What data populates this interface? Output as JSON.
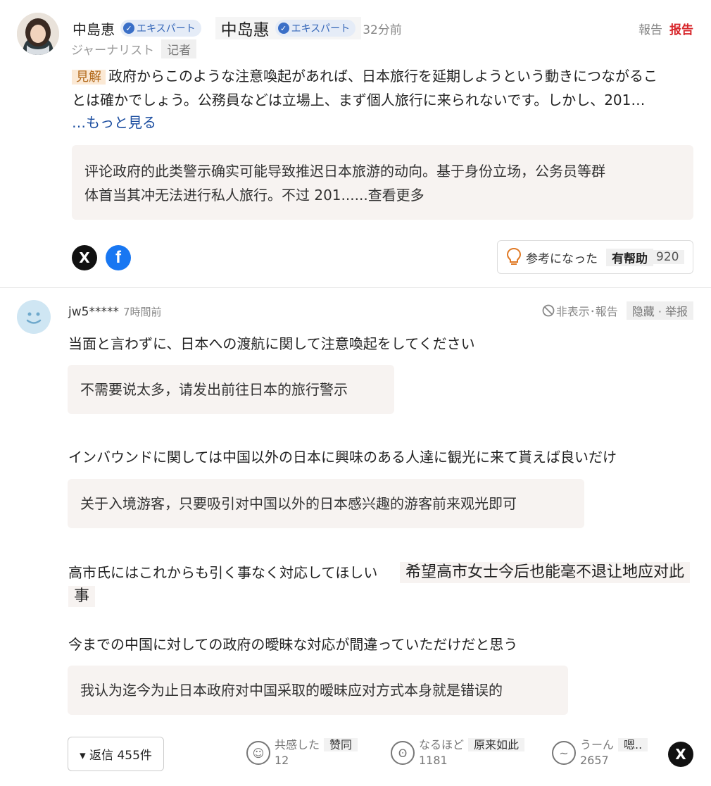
{
  "expert_comment": {
    "author_name": "中島恵",
    "badge": "エキスパート",
    "author_name_zh": "中岛惠",
    "time": "32分前",
    "role": "ジャーナリスト",
    "role_zh": "记者",
    "report_label": "報告",
    "report_label_zh": "报告",
    "opinion_tag": "見解",
    "body_line1": "政府からこのような注意喚起があれば、日本旅行を延期しようという動きにつながるこ",
    "body_line2": "とは確かでしょう。公務員などは立場上、まず個人旅行に来られないです。しかし、201…",
    "see_more": "…もっと見る",
    "translation_line1": "评论政府的此类警示确实可能导致推迟日本旅游的动向。基于身份立场，公务员等群",
    "translation_line2": "体首当其冲无法进行私人旅行。不过 201......查看更多",
    "helpful_label": "参考になった",
    "helpful_label_zh": "有帮助",
    "helpful_count": "920",
    "share_x": "X",
    "share_fb": "f"
  },
  "user_comment": {
    "username": "jw5*****",
    "time": "7時間前",
    "hide_report": "非表示･報告",
    "hide_report_zh": "隐藏 · 举报",
    "paragraphs": [
      {
        "jp": "当面と言わずに、日本への渡航に関して注意喚起をしてください",
        "zh": "不需要说太多，请发出前往日本的旅行警示"
      },
      {
        "jp": "インバウンドに関しては中国以外の日本に興味のある人達に観光に来て貰えば良いだけ",
        "zh": "关于入境游客，只要吸引对中国以外的日本感兴趣的游客前来观光即可"
      },
      {
        "jp": "高市氏にはこれからも引く事なく対応してほしい",
        "zh_line1": "希望高市女士今后也能毫不退让地应对此",
        "zh_line2": "事"
      },
      {
        "jp": "今までの中国に対しての政府の曖昧な対応が間違っていただけだと思う",
        "zh": "我认为迄今为止日本政府对中国采取的暧昧应对方式本身就是错误的"
      }
    ],
    "reply_button": "▾ 返信 455件",
    "reactions": [
      {
        "label": "共感した",
        "label_zh": "赞同",
        "count": "12"
      },
      {
        "label": "なるほど",
        "label_zh": "原来如此",
        "count": "1181"
      },
      {
        "label": "うーん",
        "label_zh": "嗯..",
        "count": "2657"
      }
    ]
  },
  "colors": {
    "accent_blue": "#1c4ea0",
    "report_red": "#d7262b",
    "translation_bg": "#f7f3f1",
    "badge_bg": "#e5ecf7",
    "facebook": "#1877f2"
  }
}
